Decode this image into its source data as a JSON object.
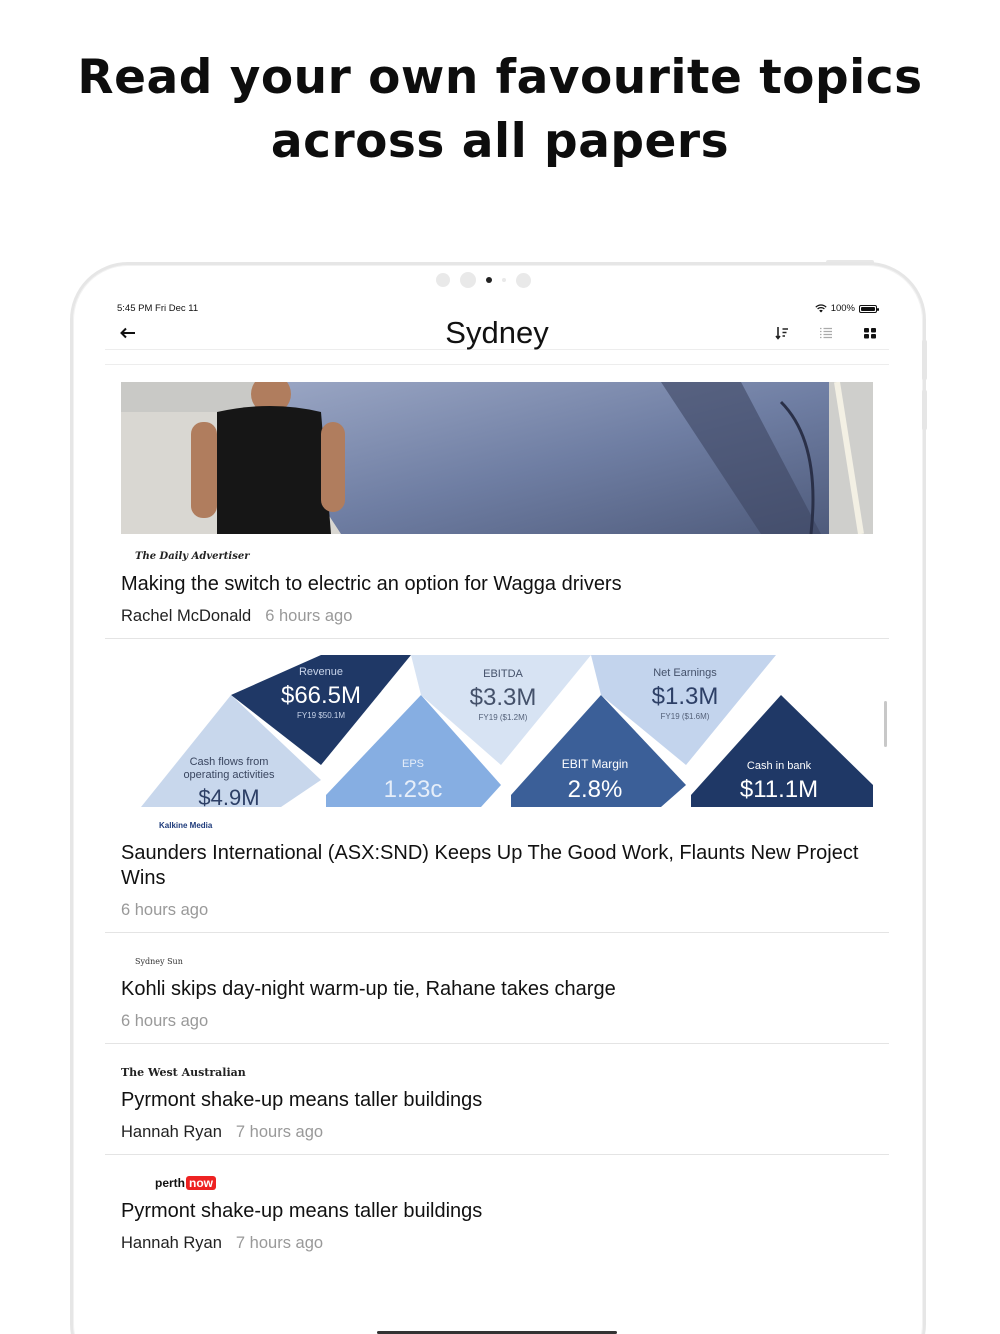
{
  "headline": "Read your own favourite topics across all papers",
  "status_bar": {
    "time": "5:45 PM   Fri Dec 11",
    "battery": "100%"
  },
  "nav": {
    "title": "Sydney",
    "back_icon": "arrow-left-icon",
    "icons": [
      "sort-icon",
      "list-view-icon",
      "grid-view-icon"
    ]
  },
  "articles": [
    {
      "source": "The Daily Advertiser",
      "title": "Making the switch to electric an option for Wagga drivers",
      "author": "Rachel McDonald",
      "time": "6 hours ago",
      "image": "person-beside-electric-car"
    },
    {
      "source": "Kalkine Media",
      "title": "Saunders International (ASX:SND) Keeps Up The Good Work, Flaunts New Project Wins",
      "author": "",
      "time": "6 hours ago",
      "image": "financial-highlights-diamonds",
      "infographic": {
        "revenue_label": "Revenue",
        "revenue_value": "$66.5M",
        "revenue_sub": "FY19 $50.1M",
        "ebitda_label": "EBITDA",
        "ebitda_value": "$3.3M",
        "ebitda_sub": "FY19 ($1.2M)",
        "net_label": "Net Earnings",
        "net_value": "$1.3M",
        "net_sub": "FY19 ($1.6M)",
        "cash_flow_label_1": "Cash flows from",
        "cash_flow_label_2": "operating activities",
        "cash_flow_value": "$4.9M",
        "eps_label": "EPS",
        "eps_value": "1.23c",
        "ebit_label": "EBIT Margin",
        "ebit_value": "2.8%",
        "bank_label": "Cash in bank",
        "bank_value": "$11.1M"
      }
    },
    {
      "source": "Sydney Sun",
      "title": "Kohli skips day-night warm-up tie, Rahane takes charge",
      "author": "",
      "time": "6 hours ago"
    },
    {
      "source": "The West Australian",
      "title": "Pyrmont shake-up means taller buildings",
      "author": "Hannah Ryan",
      "time": "7 hours ago"
    },
    {
      "source_prefix": "perth",
      "source_suffix": "now",
      "title": "Pyrmont shake-up means taller buildings",
      "author": "Hannah Ryan",
      "time": "7 hours ago"
    }
  ]
}
